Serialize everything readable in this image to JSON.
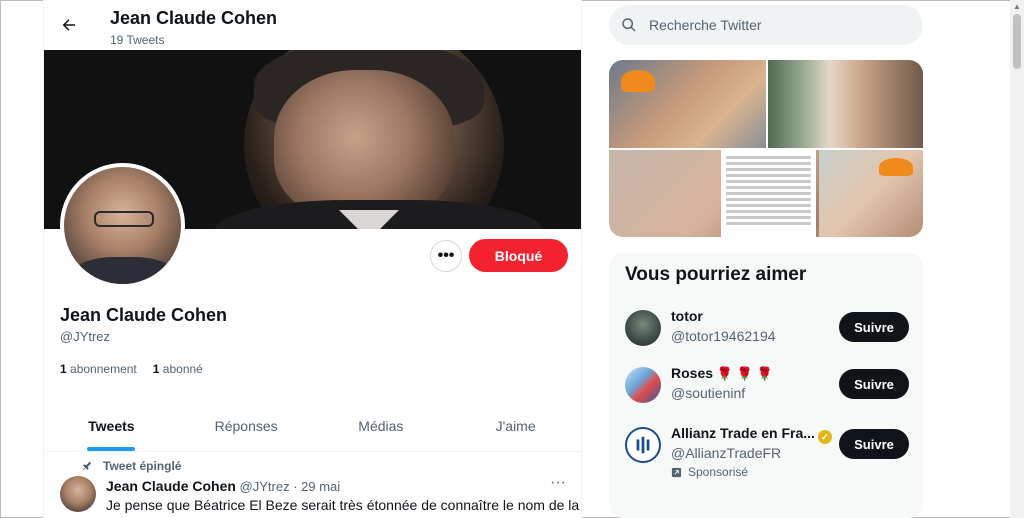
{
  "header": {
    "name": "Jean Claude Cohen",
    "tweet_count": "19 Tweets"
  },
  "profile": {
    "name": "Jean Claude Cohen",
    "handle": "@JYtrez",
    "following_count": "1",
    "following_label": "abonnement",
    "followers_count": "1",
    "followers_label": "abonné",
    "blocked_label": "Bloqué",
    "more_label": "•••"
  },
  "tabs": [
    {
      "label": "Tweets",
      "active": true
    },
    {
      "label": "Réponses",
      "active": false
    },
    {
      "label": "Médias",
      "active": false
    },
    {
      "label": "J'aime",
      "active": false
    }
  ],
  "pinned_tweet": {
    "pinned_label": "Tweet épinglé",
    "author_name": "Jean Claude Cohen",
    "author_handle": "@JYtrez",
    "date": "· 29 mai",
    "text": "Je pense que Béatrice El Beze serait très étonnée de connaître le nom de la",
    "more": "···"
  },
  "search": {
    "placeholder": "Recherche Twitter"
  },
  "suggestions": {
    "title": "Vous pourriez aimer",
    "follow_label": "Suivre",
    "users": [
      {
        "name": "totor",
        "handle": "@totor19462194"
      },
      {
        "name": "Roses",
        "emoji": "🌹 🌹 🌹",
        "handle": "@soutieninf"
      },
      {
        "name": "Allianz Trade en Fra...",
        "handle": "@AllianzTradeFR",
        "sponsored": "Sponsorisé"
      }
    ]
  },
  "colors": {
    "accent": "#1d9bf0",
    "blocked": "#f4212e",
    "text": "#0f1419",
    "muted": "#536471"
  }
}
